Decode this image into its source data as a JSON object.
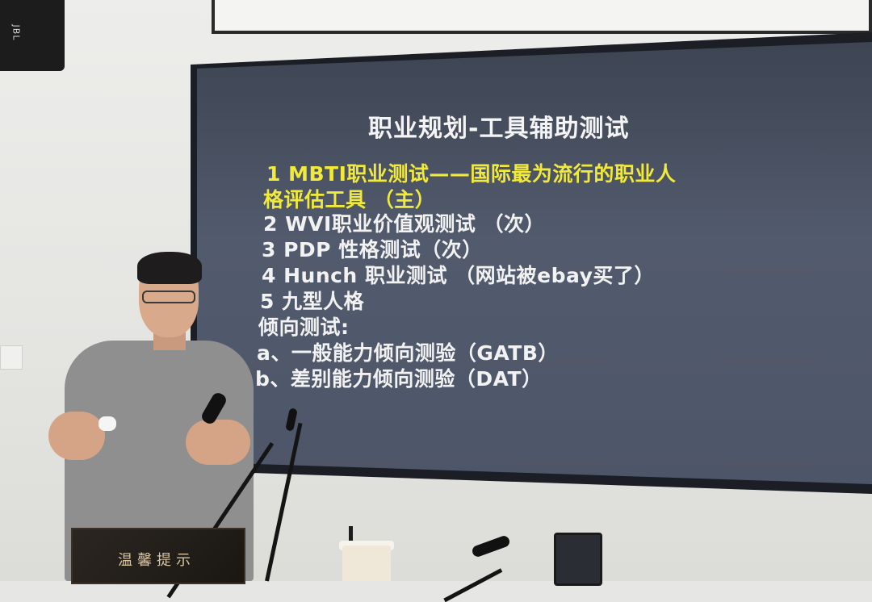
{
  "slide": {
    "title": "职业规划-工具辅助测试",
    "lines": [
      "1 MBTI职业测试——国际最为流行的职业人",
      "格评估工具 （主）",
      "2 WVI职业价值观测试 （次）",
      "3 PDP 性格测试（次）",
      "4 Hunch 职业测试 （网站被ebay买了）",
      "5 九型人格",
      "倾向测试:",
      "a、一般能力倾向测验（GATB）",
      "b、差别能力倾向测验（DAT）"
    ]
  },
  "desk_sign": {
    "text": "温馨提示"
  },
  "speaker_logo": "JBL",
  "colors": {
    "slide_background": "#4d5668",
    "slide_text": "#f2f2f2",
    "highlight_text": "#f1ea3a"
  }
}
